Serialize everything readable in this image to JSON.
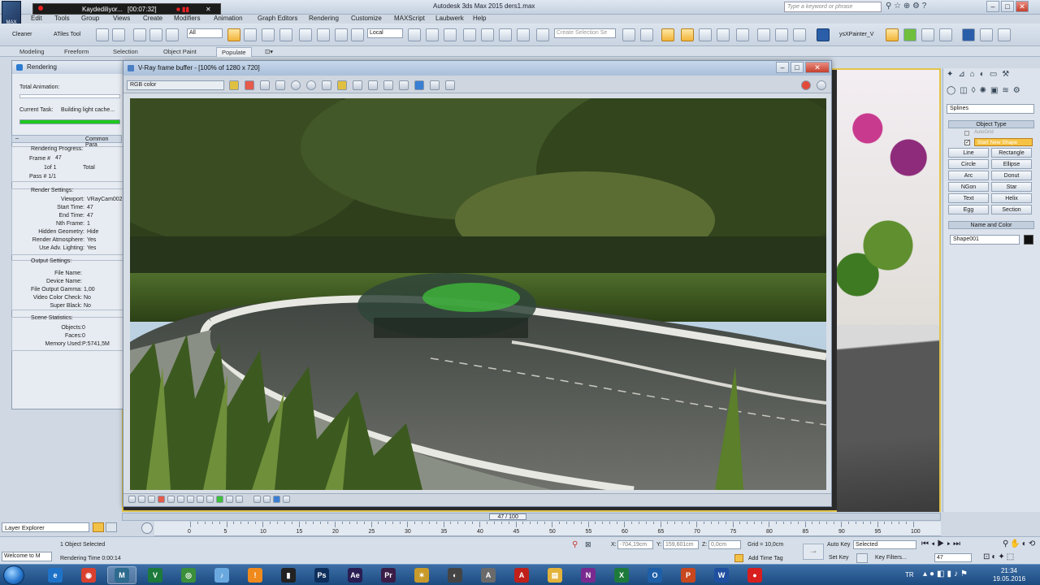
{
  "app": {
    "title": "Autodesk 3ds Max 2015   ders1.max",
    "help_placeholder": "Type a keyword or phrase"
  },
  "recorder": {
    "label": "Kaydediliyor...",
    "time": "[00:07:32]"
  },
  "menu": [
    "Edit",
    "Tools",
    "Group",
    "Views",
    "Create",
    "Modifiers",
    "Animation",
    "Graph Editors",
    "Rendering",
    "Customize",
    "MAXScript",
    "Laubwerk",
    "Help"
  ],
  "toolbar": {
    "cleaner": "Cleaner",
    "atiles": "ATiles Tool",
    "filter": "All",
    "coord": "Local",
    "selection_set": "Create Selection Se",
    "painter": "ysXPainter_V"
  },
  "ribbon_tabs": [
    "Modeling",
    "Freeform",
    "Selection",
    "Object Paint",
    "Populate"
  ],
  "ribbon_active": "Populate",
  "rendering_dialog": {
    "title": "Rendering",
    "total_animation": "Total Animation:",
    "current_task_label": "Current Task:",
    "current_task_value": "Building light cache...",
    "progress": 1.0,
    "common_params": "Common Para",
    "progress_header": "Rendering Progress:",
    "frame_label": "Frame #",
    "frame_value": "47",
    "of_text": "1of  1",
    "total_label": "Total",
    "pass_text": "Pass #  1/1",
    "settings_header": "Render Settings:",
    "settings": [
      {
        "k": "Viewport:",
        "v": "VRayCam002"
      },
      {
        "k": "Start Time:",
        "v": "47"
      },
      {
        "k": "End Time:",
        "v": "47"
      },
      {
        "k": "Nth Frame:",
        "v": "1"
      },
      {
        "k": "Hidden Geometry:",
        "v": "Hide"
      },
      {
        "k": "Render Atmosphere:",
        "v": "Yes"
      },
      {
        "k": "Use Adv. Lighting:",
        "v": "Yes"
      }
    ],
    "output_header": "Output Settings:",
    "output": [
      {
        "k": "File Name:",
        "v": ""
      },
      {
        "k": "Device Name:",
        "v": ""
      },
      {
        "k": "File Output Gamma:",
        "v": "1,00"
      },
      {
        "k": "Video Color Check:",
        "v": "No"
      },
      {
        "k": "Super Black:",
        "v": "No"
      }
    ],
    "scene_header": "Scene Statistics:",
    "scene": [
      {
        "k": "Objects:",
        "v": "0"
      },
      {
        "k": "Faces:",
        "v": "0"
      },
      {
        "k": "Memory Used:",
        "v": "P:5741,5M"
      }
    ]
  },
  "vfb": {
    "title": "V-Ray frame buffer - [100% of 1280 x 720]",
    "channel": "RGB color"
  },
  "command_panel": {
    "category": "Splines",
    "object_type_header": "Object Type",
    "autogrid": "AutoGrid",
    "start_new_shape": "Start New Shape",
    "buttons": [
      "Line",
      "Rectangle",
      "Circle",
      "Ellipse",
      "Arc",
      "Donut",
      "NGon",
      "Star",
      "Text",
      "Helix",
      "Egg",
      "Section"
    ],
    "name_color_header": "Name and Color",
    "object_name": "Shape001",
    "color": "#111111"
  },
  "timeline": {
    "slider_label": "47 / 100",
    "slider_value": 0.47,
    "ticks": [
      "0",
      "5",
      "10",
      "15",
      "20",
      "25",
      "30",
      "35",
      "40",
      "45",
      "50",
      "55",
      "60",
      "65",
      "70",
      "75",
      "80",
      "85",
      "90",
      "95",
      "100"
    ]
  },
  "status": {
    "layer_explorer": "Layer Explorer",
    "objects_selected": "1 Object Selected",
    "rendering_time": "Rendering Time  0:00:14",
    "maxscript": "Welcome to M",
    "x": "-704,19cm",
    "y": "159,601cm",
    "z": "0,0cm",
    "grid": "Grid = 10,0cm",
    "add_time_tag": "Add Time Tag",
    "auto_key": "Auto Key",
    "set_key": "Set Key",
    "key_filters": "Key Filters...",
    "selected": "Selected",
    "frame": "47",
    "x_label": "X:",
    "y_label": "Y:",
    "z_label": "Z:"
  },
  "taskbar": {
    "apps": [
      {
        "name": "ie",
        "label": "e",
        "color": "#1e73c8"
      },
      {
        "name": "chrome",
        "label": "◉",
        "color": "#d8412f"
      },
      {
        "name": "3dsmax",
        "label": "M",
        "color": "#2d6b8f",
        "open": true
      },
      {
        "name": "vray",
        "label": "V",
        "color": "#1c7a3b"
      },
      {
        "name": "globe",
        "label": "◎",
        "color": "#3b8f3b"
      },
      {
        "name": "itunes",
        "label": "♪",
        "color": "#6aa9e0"
      },
      {
        "name": "avast",
        "label": "!",
        "color": "#f08a1c"
      },
      {
        "name": "cmd",
        "label": "▮",
        "color": "#222222"
      },
      {
        "name": "photoshop",
        "label": "Ps",
        "color": "#0e2f5c"
      },
      {
        "name": "aftereffects",
        "label": "Ae",
        "color": "#2a1d53"
      },
      {
        "name": "premiere",
        "label": "Pr",
        "color": "#3a1d47"
      },
      {
        "name": "tool",
        "label": "✶",
        "color": "#c79a2a"
      },
      {
        "name": "ffmpeg",
        "label": "◐",
        "color": "#444444"
      },
      {
        "name": "inkscape",
        "label": "A",
        "color": "#6a6a6a"
      },
      {
        "name": "acrobat",
        "label": "A",
        "color": "#c0201a"
      },
      {
        "name": "explorer",
        "label": "▤",
        "color": "#e3b33a"
      },
      {
        "name": "onenote",
        "label": "N",
        "color": "#7a2a8f"
      },
      {
        "name": "excel",
        "label": "X",
        "color": "#1e7a3b"
      },
      {
        "name": "outlook",
        "label": "O",
        "color": "#1e5fa8"
      },
      {
        "name": "powerpoint",
        "label": "P",
        "color": "#c8471e"
      },
      {
        "name": "word",
        "label": "W",
        "color": "#1e4fa0"
      },
      {
        "name": "recorder",
        "label": "●",
        "color": "#d81e1e"
      }
    ],
    "lang": "TR",
    "time": "21:34",
    "date": "19.05.2016"
  }
}
